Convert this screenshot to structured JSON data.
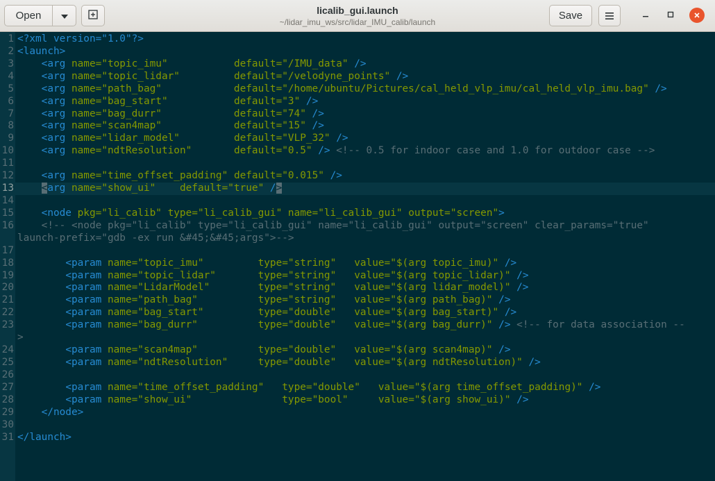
{
  "header": {
    "open_label": "Open",
    "save_label": "Save",
    "title": "licalib_gui.launch",
    "subtitle": "~/lidar_imu_ws/src/lidar_IMU_calib/launch"
  },
  "editor": {
    "current_line": 13,
    "lines": [
      {
        "n": "1",
        "segs": [
          [
            "pi",
            "<?xml version=\"1.0\"?>"
          ]
        ]
      },
      {
        "n": "2",
        "segs": [
          [
            "tag",
            "<launch>"
          ]
        ]
      },
      {
        "n": "3",
        "segs": [
          [
            "plain",
            "    "
          ],
          [
            "tag",
            "<arg "
          ],
          [
            "attr",
            "name="
          ],
          [
            "val",
            "\"topic_imu\""
          ],
          [
            "plain",
            "           "
          ],
          [
            "attr",
            "default="
          ],
          [
            "val",
            "\"/IMU_data\""
          ],
          [
            "tag",
            " />"
          ]
        ]
      },
      {
        "n": "4",
        "segs": [
          [
            "plain",
            "    "
          ],
          [
            "tag",
            "<arg "
          ],
          [
            "attr",
            "name="
          ],
          [
            "val",
            "\"topic_lidar\""
          ],
          [
            "plain",
            "         "
          ],
          [
            "attr",
            "default="
          ],
          [
            "val",
            "\"/velodyne_points\""
          ],
          [
            "tag",
            " />"
          ]
        ]
      },
      {
        "n": "5",
        "segs": [
          [
            "plain",
            "    "
          ],
          [
            "tag",
            "<arg "
          ],
          [
            "attr",
            "name="
          ],
          [
            "val",
            "\"path_bag\""
          ],
          [
            "plain",
            "            "
          ],
          [
            "attr",
            "default="
          ],
          [
            "val",
            "\"/home/ubuntu/Pictures/cal_held_vlp_imu/cal_held_vlp_imu.bag\""
          ],
          [
            "tag",
            " />"
          ]
        ]
      },
      {
        "n": "6",
        "segs": [
          [
            "plain",
            "    "
          ],
          [
            "tag",
            "<arg "
          ],
          [
            "attr",
            "name="
          ],
          [
            "val",
            "\"bag_start\""
          ],
          [
            "plain",
            "           "
          ],
          [
            "attr",
            "default="
          ],
          [
            "val",
            "\"3\""
          ],
          [
            "tag",
            " />"
          ]
        ]
      },
      {
        "n": "7",
        "segs": [
          [
            "plain",
            "    "
          ],
          [
            "tag",
            "<arg "
          ],
          [
            "attr",
            "name="
          ],
          [
            "val",
            "\"bag_durr\""
          ],
          [
            "plain",
            "            "
          ],
          [
            "attr",
            "default="
          ],
          [
            "val",
            "\"74\""
          ],
          [
            "tag",
            " />"
          ]
        ]
      },
      {
        "n": "8",
        "segs": [
          [
            "plain",
            "    "
          ],
          [
            "tag",
            "<arg "
          ],
          [
            "attr",
            "name="
          ],
          [
            "val",
            "\"scan4map\""
          ],
          [
            "plain",
            "            "
          ],
          [
            "attr",
            "default="
          ],
          [
            "val",
            "\"15\""
          ],
          [
            "tag",
            " />"
          ]
        ]
      },
      {
        "n": "9",
        "segs": [
          [
            "plain",
            "    "
          ],
          [
            "tag",
            "<arg "
          ],
          [
            "attr",
            "name="
          ],
          [
            "val",
            "\"lidar_model\""
          ],
          [
            "plain",
            "         "
          ],
          [
            "attr",
            "default="
          ],
          [
            "val",
            "\"VLP_32\""
          ],
          [
            "tag",
            " />"
          ]
        ]
      },
      {
        "n": "10",
        "segs": [
          [
            "plain",
            "    "
          ],
          [
            "tag",
            "<arg "
          ],
          [
            "attr",
            "name="
          ],
          [
            "val",
            "\"ndtResolution\""
          ],
          [
            "plain",
            "       "
          ],
          [
            "attr",
            "default="
          ],
          [
            "val",
            "\"0.5\""
          ],
          [
            "tag",
            " />"
          ],
          [
            "cmt",
            " <!-- 0.5 for indoor case and 1.0 for outdoor case -->"
          ]
        ]
      },
      {
        "n": "11",
        "segs": []
      },
      {
        "n": "12",
        "segs": [
          [
            "plain",
            "    "
          ],
          [
            "tag",
            "<arg "
          ],
          [
            "attr",
            "name="
          ],
          [
            "val",
            "\"time_offset_padding\""
          ],
          [
            "plain",
            " "
          ],
          [
            "attr",
            "default="
          ],
          [
            "val",
            "\"0.015\""
          ],
          [
            "tag",
            " />"
          ]
        ]
      },
      {
        "n": "13",
        "segs": [
          [
            "plain",
            "    "
          ],
          [
            "cursor",
            "<"
          ],
          [
            "tag",
            "arg "
          ],
          [
            "attr",
            "name="
          ],
          [
            "val",
            "\"show_ui\""
          ],
          [
            "plain",
            "    "
          ],
          [
            "attr",
            "default="
          ],
          [
            "val",
            "\"true\""
          ],
          [
            "tag",
            " /"
          ],
          [
            "cursor",
            ">"
          ]
        ]
      },
      {
        "n": "14",
        "segs": []
      },
      {
        "n": "15",
        "segs": [
          [
            "plain",
            "    "
          ],
          [
            "tag",
            "<node "
          ],
          [
            "attr",
            "pkg="
          ],
          [
            "val",
            "\"li_calib\""
          ],
          [
            "plain",
            " "
          ],
          [
            "attr",
            "type="
          ],
          [
            "val",
            "\"li_calib_gui\""
          ],
          [
            "plain",
            " "
          ],
          [
            "attr",
            "name="
          ],
          [
            "val",
            "\"li_calib_gui\""
          ],
          [
            "plain",
            " "
          ],
          [
            "attr",
            "output="
          ],
          [
            "val",
            "\"screen\""
          ],
          [
            "tag",
            ">"
          ]
        ]
      },
      {
        "n": "16",
        "segs": [
          [
            "cmt",
            "    <!-- <node pkg=\"li_calib\" type=\"li_calib_gui\" name=\"li_calib_gui\" output=\"screen\" clear_params=\"true\""
          ]
        ]
      },
      {
        "n": "",
        "segs": [
          [
            "cmt",
            "launch-prefix=\"gdb -ex run &#45;&#45;args\">-->"
          ]
        ]
      },
      {
        "n": "17",
        "segs": []
      },
      {
        "n": "18",
        "segs": [
          [
            "plain",
            "        "
          ],
          [
            "tag",
            "<param "
          ],
          [
            "attr",
            "name="
          ],
          [
            "val",
            "\"topic_imu\""
          ],
          [
            "plain",
            "         "
          ],
          [
            "attr",
            "type="
          ],
          [
            "val",
            "\"string\""
          ],
          [
            "plain",
            "   "
          ],
          [
            "attr",
            "value="
          ],
          [
            "val",
            "\"$(arg topic_imu)\""
          ],
          [
            "tag",
            " />"
          ]
        ]
      },
      {
        "n": "19",
        "segs": [
          [
            "plain",
            "        "
          ],
          [
            "tag",
            "<param "
          ],
          [
            "attr",
            "name="
          ],
          [
            "val",
            "\"topic_lidar\""
          ],
          [
            "plain",
            "       "
          ],
          [
            "attr",
            "type="
          ],
          [
            "val",
            "\"string\""
          ],
          [
            "plain",
            "   "
          ],
          [
            "attr",
            "value="
          ],
          [
            "val",
            "\"$(arg topic_lidar)\""
          ],
          [
            "tag",
            " />"
          ]
        ]
      },
      {
        "n": "20",
        "segs": [
          [
            "plain",
            "        "
          ],
          [
            "tag",
            "<param "
          ],
          [
            "attr",
            "name="
          ],
          [
            "val",
            "\"LidarModel\""
          ],
          [
            "plain",
            "        "
          ],
          [
            "attr",
            "type="
          ],
          [
            "val",
            "\"string\""
          ],
          [
            "plain",
            "   "
          ],
          [
            "attr",
            "value="
          ],
          [
            "val",
            "\"$(arg lidar_model)\""
          ],
          [
            "tag",
            " />"
          ]
        ]
      },
      {
        "n": "21",
        "segs": [
          [
            "plain",
            "        "
          ],
          [
            "tag",
            "<param "
          ],
          [
            "attr",
            "name="
          ],
          [
            "val",
            "\"path_bag\""
          ],
          [
            "plain",
            "          "
          ],
          [
            "attr",
            "type="
          ],
          [
            "val",
            "\"string\""
          ],
          [
            "plain",
            "   "
          ],
          [
            "attr",
            "value="
          ],
          [
            "val",
            "\"$(arg path_bag)\""
          ],
          [
            "tag",
            " />"
          ]
        ]
      },
      {
        "n": "22",
        "segs": [
          [
            "plain",
            "        "
          ],
          [
            "tag",
            "<param "
          ],
          [
            "attr",
            "name="
          ],
          [
            "val",
            "\"bag_start\""
          ],
          [
            "plain",
            "         "
          ],
          [
            "attr",
            "type="
          ],
          [
            "val",
            "\"double\""
          ],
          [
            "plain",
            "   "
          ],
          [
            "attr",
            "value="
          ],
          [
            "val",
            "\"$(arg bag_start)\""
          ],
          [
            "tag",
            " />"
          ]
        ]
      },
      {
        "n": "23",
        "segs": [
          [
            "plain",
            "        "
          ],
          [
            "tag",
            "<param "
          ],
          [
            "attr",
            "name="
          ],
          [
            "val",
            "\"bag_durr\""
          ],
          [
            "plain",
            "          "
          ],
          [
            "attr",
            "type="
          ],
          [
            "val",
            "\"double\""
          ],
          [
            "plain",
            "   "
          ],
          [
            "attr",
            "value="
          ],
          [
            "val",
            "\"$(arg bag_durr)\""
          ],
          [
            "tag",
            " />"
          ],
          [
            "cmt",
            " <!-- for data association --"
          ]
        ]
      },
      {
        "n": "",
        "segs": [
          [
            "cmt",
            ">"
          ]
        ]
      },
      {
        "n": "24",
        "segs": [
          [
            "plain",
            "        "
          ],
          [
            "tag",
            "<param "
          ],
          [
            "attr",
            "name="
          ],
          [
            "val",
            "\"scan4map\""
          ],
          [
            "plain",
            "          "
          ],
          [
            "attr",
            "type="
          ],
          [
            "val",
            "\"double\""
          ],
          [
            "plain",
            "   "
          ],
          [
            "attr",
            "value="
          ],
          [
            "val",
            "\"$(arg scan4map)\""
          ],
          [
            "tag",
            " />"
          ]
        ]
      },
      {
        "n": "25",
        "segs": [
          [
            "plain",
            "        "
          ],
          [
            "tag",
            "<param "
          ],
          [
            "attr",
            "name="
          ],
          [
            "val",
            "\"ndtResolution\""
          ],
          [
            "plain",
            "     "
          ],
          [
            "attr",
            "type="
          ],
          [
            "val",
            "\"double\""
          ],
          [
            "plain",
            "   "
          ],
          [
            "attr",
            "value="
          ],
          [
            "val",
            "\"$(arg ndtResolution)\""
          ],
          [
            "tag",
            " />"
          ]
        ]
      },
      {
        "n": "26",
        "segs": []
      },
      {
        "n": "27",
        "segs": [
          [
            "plain",
            "        "
          ],
          [
            "tag",
            "<param "
          ],
          [
            "attr",
            "name="
          ],
          [
            "val",
            "\"time_offset_padding\""
          ],
          [
            "plain",
            "   "
          ],
          [
            "attr",
            "type="
          ],
          [
            "val",
            "\"double\""
          ],
          [
            "plain",
            "   "
          ],
          [
            "attr",
            "value="
          ],
          [
            "val",
            "\"$(arg time_offset_padding)\""
          ],
          [
            "tag",
            " />"
          ]
        ]
      },
      {
        "n": "28",
        "segs": [
          [
            "plain",
            "        "
          ],
          [
            "tag",
            "<param "
          ],
          [
            "attr",
            "name="
          ],
          [
            "val",
            "\"show_ui\""
          ],
          [
            "plain",
            "               "
          ],
          [
            "attr",
            "type="
          ],
          [
            "val",
            "\"bool\""
          ],
          [
            "plain",
            "     "
          ],
          [
            "attr",
            "value="
          ],
          [
            "val",
            "\"$(arg show_ui)\""
          ],
          [
            "tag",
            " />"
          ]
        ]
      },
      {
        "n": "29",
        "segs": [
          [
            "plain",
            "    "
          ],
          [
            "tag",
            "</node>"
          ]
        ]
      },
      {
        "n": "30",
        "segs": []
      },
      {
        "n": "31",
        "segs": [
          [
            "tag",
            "</launch>"
          ]
        ]
      }
    ]
  }
}
